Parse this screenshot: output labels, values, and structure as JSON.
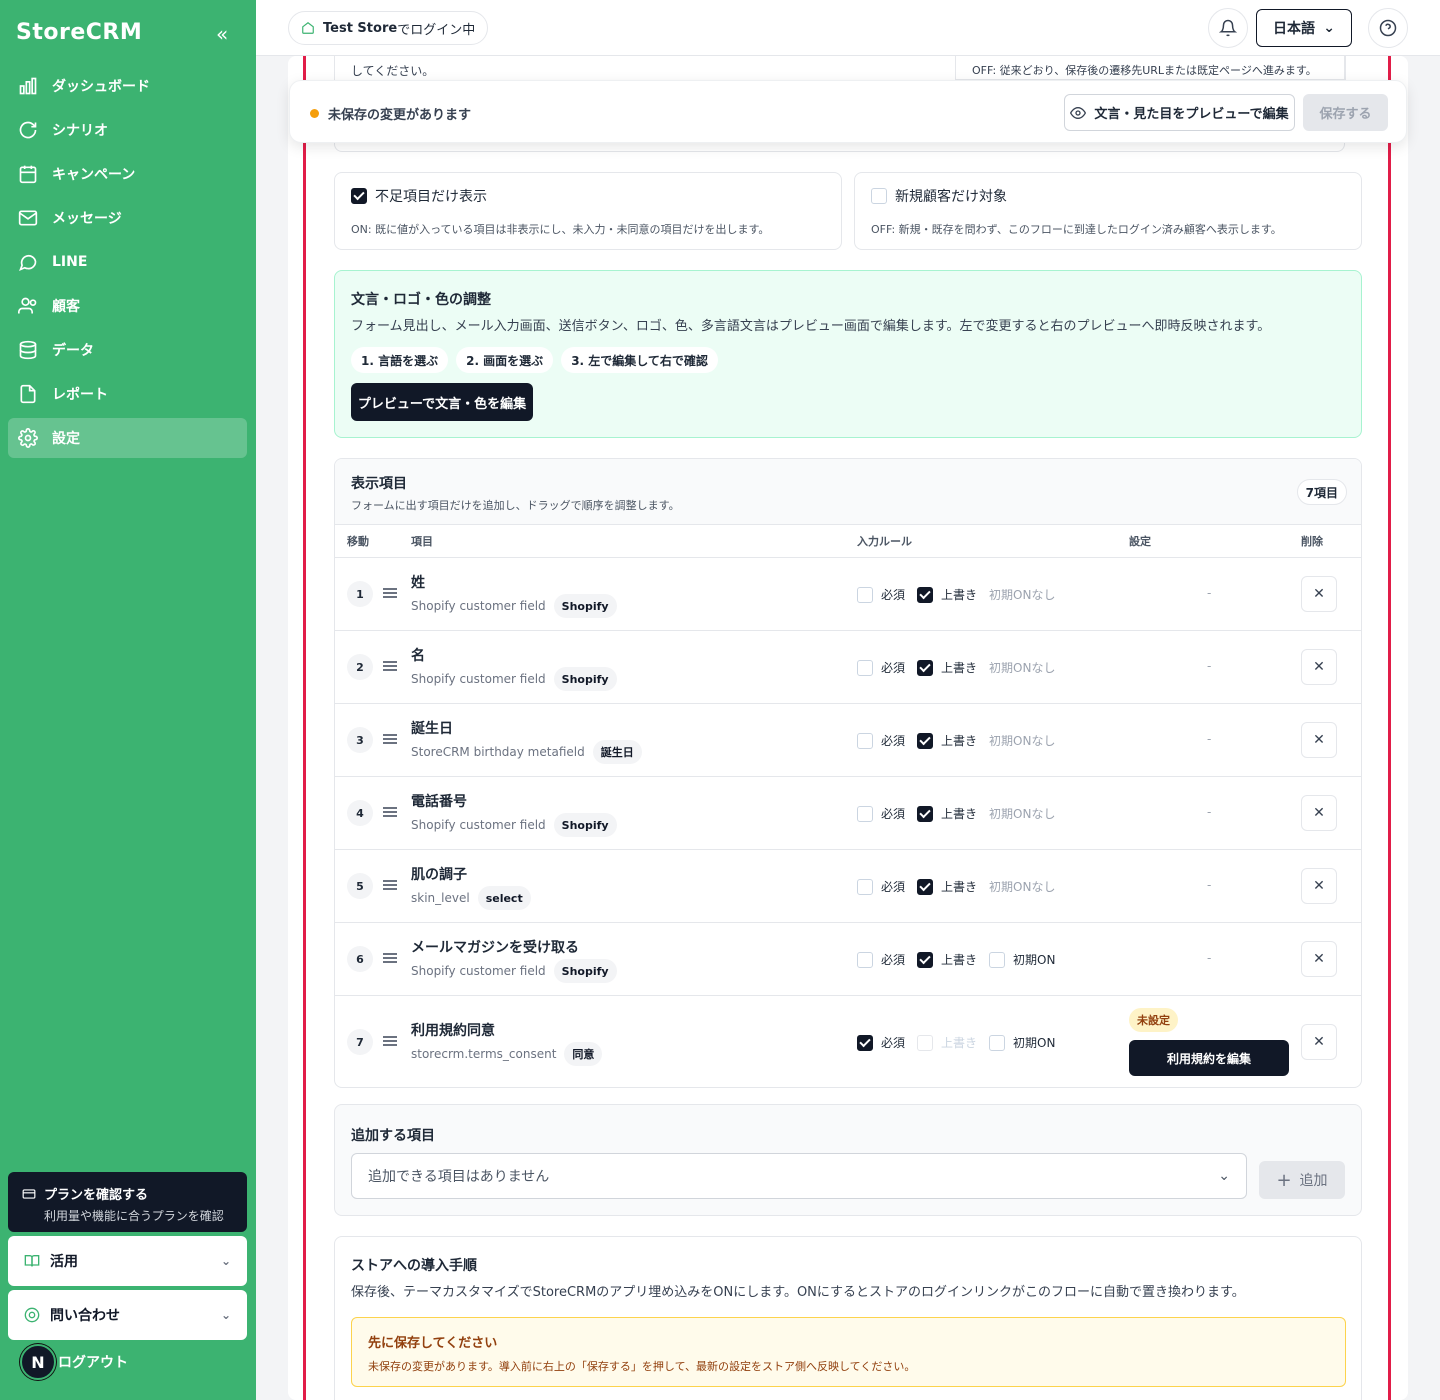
{
  "sidebar": {
    "logo": "StoreCRM",
    "collapse_icon": "«",
    "items": [
      {
        "label": "ダッシュボード",
        "icon": "bar-chart-icon"
      },
      {
        "label": "シナリオ",
        "icon": "refresh-icon"
      },
      {
        "label": "キャンペーン",
        "icon": "calendar-icon"
      },
      {
        "label": "メッセージ",
        "icon": "mail-icon"
      },
      {
        "label": "LINE",
        "icon": "chat-icon"
      },
      {
        "label": "顧客",
        "icon": "users-icon"
      },
      {
        "label": "データ",
        "icon": "database-icon"
      },
      {
        "label": "レポート",
        "icon": "report-icon"
      },
      {
        "label": "設定",
        "icon": "gear-icon",
        "active": true
      }
    ],
    "plan": {
      "title": "プランを確認する",
      "subtitle": "利用量や機能に合うプランを確認"
    },
    "usage": "活用",
    "contact": "問い合わせ",
    "logout": "ログアウト",
    "avatar_letter": "N"
  },
  "header": {
    "store_prefix": "Test Store",
    "store_suffix": " でログイン中",
    "language": "日本語"
  },
  "top_partial": {
    "left_text": "してください。",
    "right_text": "OFF: 従来どおり、保存後の遷移先URLまたは既定ページへ進みます。"
  },
  "unsaved_bar": {
    "message": "未保存の変更があります",
    "preview_label": "文言・見た目をプレビューで編集",
    "save_label": "保存する"
  },
  "options": [
    {
      "label": "不足項目だけ表示",
      "checked": true,
      "desc": "ON: 既に値が入っている項目は非表示にし、未入力・未同意の項目だけを出します。"
    },
    {
      "label": "新規顧客だけ対象",
      "checked": false,
      "desc": "OFF: 新規・既存を問わず、このフローに到達したログイン済み顧客へ表示します。"
    }
  ],
  "customize": {
    "title": "文言・ロゴ・色の調整",
    "desc": "フォーム見出し、メール入力画面、送信ボタン、ロゴ、色、多言語文言はプレビュー画面で編集します。左で変更すると右のプレビューへ即時反映されます。",
    "steps": [
      "1. 言語を選ぶ",
      "2. 画面を選ぶ",
      "3. 左で編集して右で確認"
    ],
    "button": "プレビューで文言・色を編集"
  },
  "fields": {
    "title": "表示項目",
    "desc": "フォームに出す項目だけを追加し、ドラッグで順序を調整します。",
    "count": "7項目",
    "columns": {
      "move": "移動",
      "item": "項目",
      "rules": "入力ルール",
      "settings": "設定",
      "delete": "削除"
    },
    "rule_labels": {
      "required": "必須",
      "overwrite": "上書き",
      "default_on": "初期ON",
      "default_none": "初期ONなし"
    },
    "rows": [
      {
        "num": "1",
        "name": "姓",
        "source": "Shopify customer field",
        "tag": "Shopify",
        "required": false,
        "overwrite": true,
        "default": "none",
        "setting": "-"
      },
      {
        "num": "2",
        "name": "名",
        "source": "Shopify customer field",
        "tag": "Shopify",
        "required": false,
        "overwrite": true,
        "default": "none",
        "setting": "-"
      },
      {
        "num": "3",
        "name": "誕生日",
        "source": "StoreCRM birthday metafield",
        "tag": "誕生日",
        "required": false,
        "overwrite": true,
        "default": "none",
        "setting": "-"
      },
      {
        "num": "4",
        "name": "電話番号",
        "source": "Shopify customer field",
        "tag": "Shopify",
        "required": false,
        "overwrite": true,
        "default": "none",
        "setting": "-"
      },
      {
        "num": "5",
        "name": "肌の調子",
        "source": "skin_level",
        "tag": "select",
        "required": false,
        "overwrite": true,
        "default": "none",
        "setting": "-"
      },
      {
        "num": "6",
        "name": "メールマガジンを受け取る",
        "source": "Shopify customer field",
        "tag": "Shopify",
        "required": false,
        "overwrite": true,
        "default": "off",
        "setting": "-"
      },
      {
        "num": "7",
        "name": "利用規約同意",
        "source": "storecrm.terms_consent",
        "tag": "同意",
        "required": true,
        "overwrite": false,
        "overwrite_disabled": true,
        "default": "off",
        "setting_badge": "未設定",
        "setting_button": "利用規約を編集"
      }
    ]
  },
  "add_item": {
    "title": "追加する項目",
    "placeholder": "追加できる項目はありません",
    "button": "追加"
  },
  "intro": {
    "title": "ストアへの導入手順",
    "desc": "保存後、テーマカスタマイズでStoreCRMのアプリ埋め込みをONにします。ONにするとストアのログインリンクがこのフローに自動で置き換わります。",
    "warn_title": "先に保存してください",
    "warn_desc": "未保存の変更があります。導入前に右上の「保存する」を押して、最新の設定をストア側へ反映してください。"
  },
  "colors": {
    "sidebar": "#3cb371",
    "accent_red": "#e11d48",
    "dark": "#111827",
    "warning": "#f59e0b"
  }
}
